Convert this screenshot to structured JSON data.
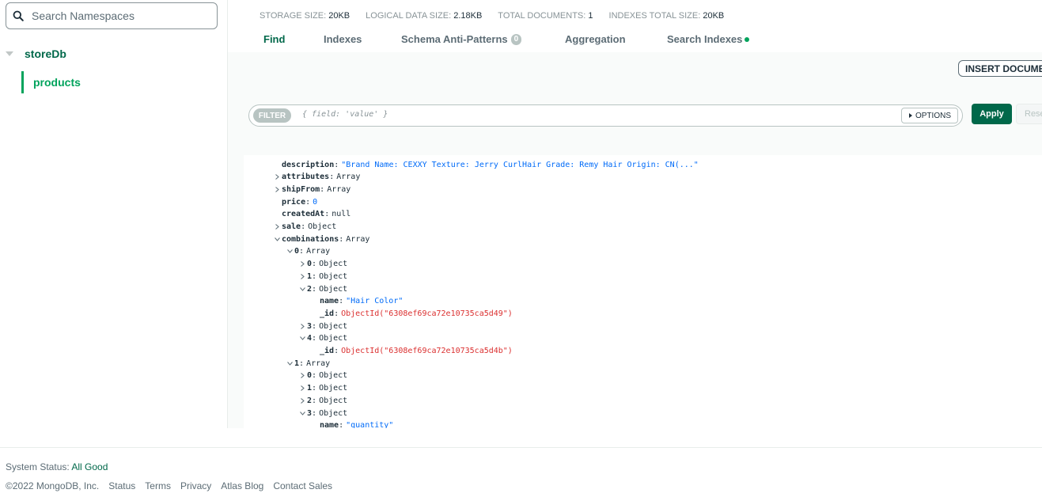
{
  "sidebar": {
    "search_placeholder": "Search Namespaces",
    "database": "storeDb",
    "collection": "products"
  },
  "stats": [
    {
      "label": "STORAGE SIZE:",
      "value": "20KB"
    },
    {
      "label": "LOGICAL DATA SIZE:",
      "value": "2.18KB"
    },
    {
      "label": "TOTAL DOCUMENTS:",
      "value": "1"
    },
    {
      "label": "INDEXES TOTAL SIZE:",
      "value": "20KB"
    }
  ],
  "tabs": {
    "find": "Find",
    "indexes": "Indexes",
    "schema": "Schema Anti-Patterns",
    "schema_count": "0",
    "aggregation": "Aggregation",
    "search_indexes": "Search Indexes"
  },
  "toolbar": {
    "insert": "INSERT DOCUME",
    "filter_chip": "FILTER",
    "filter_placeholder": "{ field: 'value' }",
    "options": "OPTIONS",
    "apply": "Apply",
    "reset": "Rese"
  },
  "colors": {
    "accent": "#00684a",
    "accent_light": "#00a35c",
    "string": "#016bf8",
    "objectid": "#db3030"
  },
  "document_lines": [
    {
      "key": "description",
      "value": "\"Brand Name: CEXXY Texture: Jerry CurlHair Grade: Remy Hair Origin: CN(...\"",
      "type": "str",
      "caret": "none"
    },
    {
      "key": "attributes",
      "value": "Array",
      "type": "type",
      "caret": "right"
    },
    {
      "key": "shipFrom",
      "value": "Array",
      "type": "type",
      "caret": "right"
    },
    {
      "key": "price",
      "value": "0",
      "type": "num",
      "caret": "none"
    },
    {
      "key": "createdAt",
      "value": "null",
      "type": "type",
      "caret": "none"
    },
    {
      "key": "sale",
      "value": "Object",
      "type": "type",
      "caret": "right"
    },
    {
      "key": "combinations",
      "value": "Array",
      "type": "type",
      "caret": "down"
    },
    {
      "key": "0",
      "value": "Array",
      "type": "type",
      "caret": "down"
    },
    {
      "key": "0",
      "value": "Object",
      "type": "type",
      "caret": "right"
    },
    {
      "key": "1",
      "value": "Object",
      "type": "type",
      "caret": "right"
    },
    {
      "key": "2",
      "value": "Object",
      "type": "type",
      "caret": "down"
    },
    {
      "key": "name",
      "value": "\"Hair Color\"",
      "type": "str",
      "caret": "none"
    },
    {
      "key": "_id",
      "value": "ObjectId(\"6308ef69ca72e10735ca5d49\")",
      "type": "oid",
      "caret": "none"
    },
    {
      "key": "3",
      "value": "Object",
      "type": "type",
      "caret": "right"
    },
    {
      "key": "4",
      "value": "Object",
      "type": "type",
      "caret": "down"
    },
    {
      "key": "_id",
      "value": "ObjectId(\"6308ef69ca72e10735ca5d4b\")",
      "type": "oid",
      "caret": "none"
    },
    {
      "key": "1",
      "value": "Array",
      "type": "type",
      "caret": "down"
    },
    {
      "key": "0",
      "value": "Object",
      "type": "type",
      "caret": "right"
    },
    {
      "key": "1",
      "value": "Object",
      "type": "type",
      "caret": "right"
    },
    {
      "key": "2",
      "value": "Object",
      "type": "type",
      "caret": "right"
    },
    {
      "key": "3",
      "value": "Object",
      "type": "type",
      "caret": "down"
    },
    {
      "key": "name",
      "value": "\"quantity\"",
      "type": "str",
      "caret": "none"
    }
  ],
  "footer": {
    "status_label": "System Status:",
    "status_value": "All Good",
    "links": [
      "©2022 MongoDB, Inc.",
      "Status",
      "Terms",
      "Privacy",
      "Atlas Blog",
      "Contact Sales"
    ]
  }
}
